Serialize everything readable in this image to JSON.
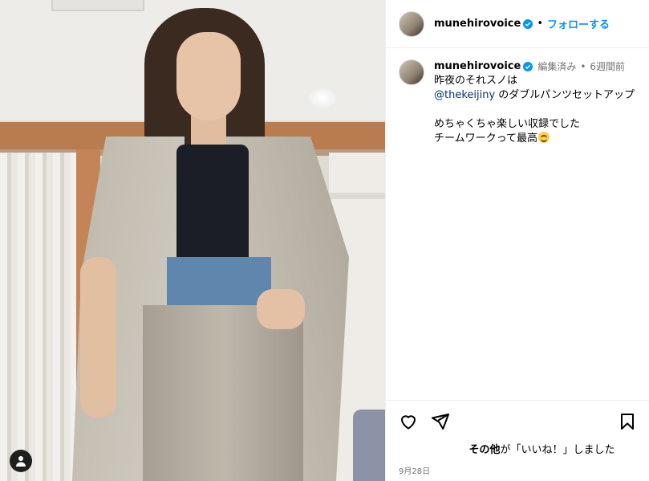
{
  "post": {
    "header": {
      "username": "munehirovoice",
      "separator": "•",
      "follow_label": "フォローする"
    },
    "caption": {
      "username": "munehirovoice",
      "edited": "編集済み",
      "separator": "•",
      "time_ago": "6週間前",
      "line1": "昨夜のそれスノは",
      "mention": "@thekeijiny",
      "line2_rest": " のダブルパンツセットアップ",
      "line3": "めちゃくちゃ楽しい収録でした",
      "line4": "チームワークって最高",
      "emoji": "smiling-face-emoji"
    },
    "likes": {
      "bold": "その他",
      "rest": "が「いいね！」しました"
    },
    "date": "9月28日"
  },
  "icons": {
    "verified": "verified-badge-icon",
    "like": "heart-icon",
    "share": "paper-plane-icon",
    "save": "bookmark-icon",
    "tagged": "person-icon"
  },
  "colors": {
    "accent": "#0095f6",
    "verified": "#0095f6",
    "mention": "#00376b",
    "secondary_text": "#737373",
    "border": "#efefef"
  }
}
